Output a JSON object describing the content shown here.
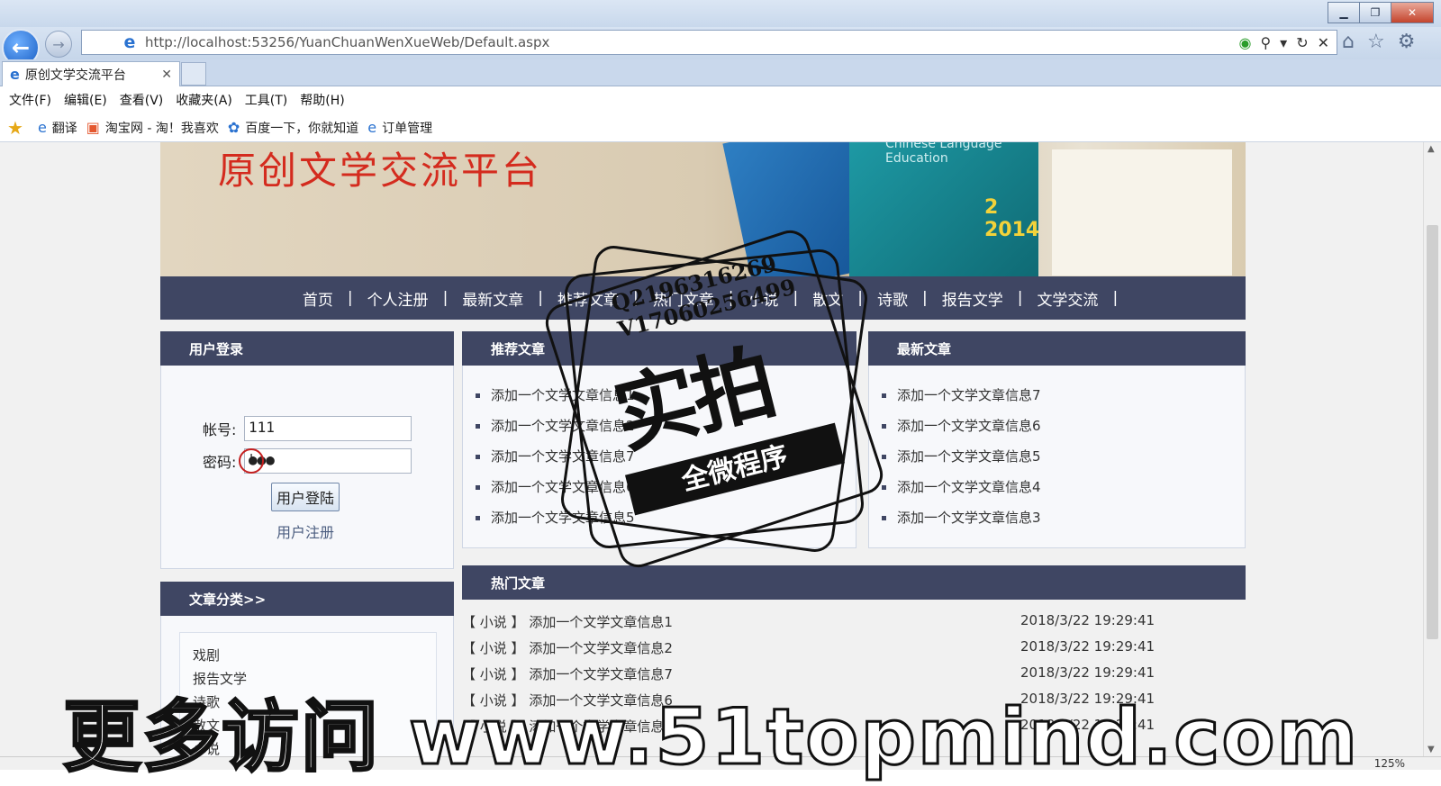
{
  "browser": {
    "url": "http://localhost:53256/YuanChuanWenXueWeb/Default.aspx",
    "tab_title": "原创文学交流平台",
    "tab_close": "✕",
    "menu": [
      "文件(F)",
      "编辑(E)",
      "查看(V)",
      "收藏夹(A)",
      "工具(T)",
      "帮助(H)"
    ],
    "favorites": [
      {
        "label": "翻译",
        "icon": "ie-icon"
      },
      {
        "label": "淘宝网 - 淘！我喜欢",
        "icon": "taobao-icon"
      },
      {
        "label": "百度一下，你就知道",
        "icon": "baidu-icon"
      },
      {
        "label": "订单管理",
        "icon": "ie-icon"
      }
    ],
    "zoom": "125%"
  },
  "banner": {
    "title": "原创文学交流平台",
    "book_text": "Chinese Language Education",
    "book_number": "2 2014"
  },
  "nav": {
    "items": [
      "首页",
      "个人注册",
      "最新文章",
      "推荐文章",
      "热门文章",
      "小说",
      "散文",
      "诗歌",
      "报告文学",
      "文学交流"
    ],
    "separator": "|"
  },
  "login": {
    "title": "用户登录",
    "account_label": "帐号:",
    "account_value": "111",
    "password_label": "密码:",
    "password_value": "●●●",
    "login_button": "用户登陆",
    "register_link": "用户注册"
  },
  "categories": {
    "title": "文章分类>>",
    "items": [
      "戏剧",
      "报告文学",
      "诗歌",
      "散文",
      "小说"
    ]
  },
  "recommended": {
    "title": "推荐文章",
    "items": [
      "添加一个文学文章信息1",
      "添加一个文学文章信息2",
      "添加一个文学文章信息7",
      "添加一个文学文章信息6",
      "添加一个文学文章信息5"
    ]
  },
  "latest": {
    "title": "最新文章",
    "items": [
      "添加一个文学文章信息7",
      "添加一个文学文章信息6",
      "添加一个文学文章信息5",
      "添加一个文学文章信息4",
      "添加一个文学文章信息3"
    ]
  },
  "hot": {
    "title": "热门文章",
    "rows": [
      {
        "cat": "【 小说 】",
        "title": "添加一个文学文章信息1",
        "date": "2018/3/22 19:29:41"
      },
      {
        "cat": "【 小说 】",
        "title": "添加一个文学文章信息2",
        "date": "2018/3/22 19:29:41"
      },
      {
        "cat": "【 小说 】",
        "title": "添加一个文学文章信息7",
        "date": "2018/3/22 19:29:41"
      },
      {
        "cat": "【 小说 】",
        "title": "添加一个文学文章信息6",
        "date": "2018/3/22 19:29:41"
      },
      {
        "cat": "【 小说 】",
        "title": "添加一个文学文章信息5",
        "date": "2018/3/22 19:29:41"
      }
    ]
  },
  "overlay": {
    "stamp_line1": "Q2196316269",
    "stamp_line2": "V17060256499",
    "stamp_big": "实拍",
    "stamp_banner": "全微程序",
    "watermark": "更多访问 www.51topmind.com"
  }
}
